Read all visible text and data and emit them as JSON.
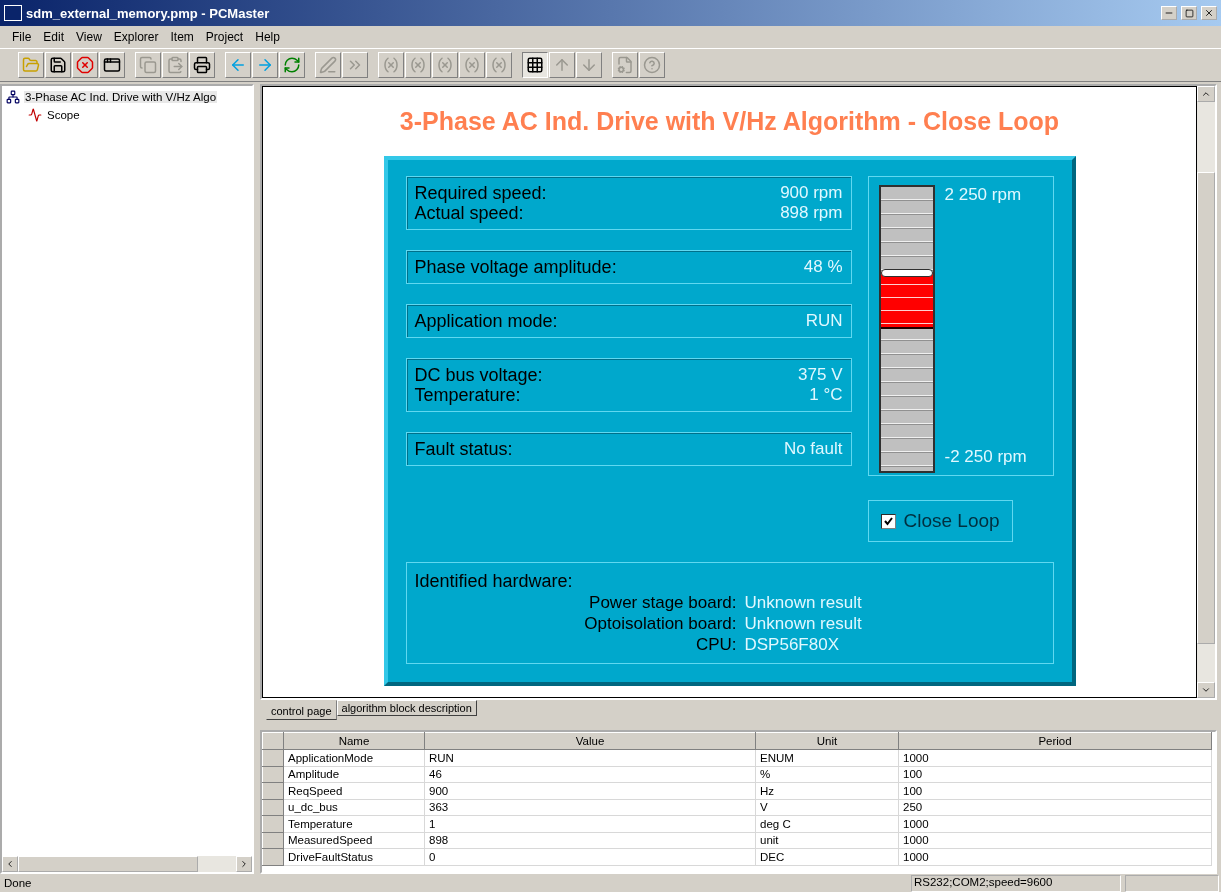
{
  "window": {
    "title": "sdm_external_memory.pmp - PCMaster"
  },
  "menu": [
    "File",
    "Edit",
    "View",
    "Explorer",
    "Item",
    "Project",
    "Help"
  ],
  "toolbar": [
    {
      "kind": "open",
      "disabled": false
    },
    {
      "kind": "save",
      "disabled": false
    },
    {
      "kind": "stop",
      "disabled": false
    },
    {
      "kind": "window",
      "disabled": false
    },
    {
      "kind": "sep"
    },
    {
      "kind": "copy",
      "disabled": true
    },
    {
      "kind": "paste",
      "disabled": true
    },
    {
      "kind": "print",
      "disabled": false
    },
    {
      "kind": "sep"
    },
    {
      "kind": "back",
      "disabled": false
    },
    {
      "kind": "forward",
      "disabled": false
    },
    {
      "kind": "refresh",
      "disabled": false
    },
    {
      "kind": "sep"
    },
    {
      "kind": "edit",
      "disabled": true
    },
    {
      "kind": "more",
      "disabled": true
    },
    {
      "kind": "sep"
    },
    {
      "kind": "var",
      "disabled": true
    },
    {
      "kind": "var",
      "disabled": true
    },
    {
      "kind": "var",
      "disabled": true
    },
    {
      "kind": "var",
      "disabled": true
    },
    {
      "kind": "var",
      "disabled": true
    },
    {
      "kind": "sep"
    },
    {
      "kind": "grid",
      "disabled": false
    },
    {
      "kind": "up",
      "disabled": true
    },
    {
      "kind": "down",
      "disabled": true
    },
    {
      "kind": "sep"
    },
    {
      "kind": "props",
      "disabled": true
    },
    {
      "kind": "help",
      "disabled": true
    }
  ],
  "tree": [
    {
      "label": "3-Phase AC Ind. Drive with V/Hz Algo",
      "selected": true,
      "children": [
        {
          "label": "Scope",
          "selected": false
        }
      ]
    }
  ],
  "page": {
    "title": "3-Phase AC Ind. Drive with V/Hz Algorithm - Close Loop",
    "groups": [
      [
        {
          "label": "Required speed:",
          "value": "900 rpm"
        },
        {
          "label": "Actual speed:",
          "value": "898 rpm"
        }
      ],
      [
        {
          "label": "Phase voltage amplitude:",
          "value": "48 %"
        }
      ],
      [
        {
          "label": "Application mode:",
          "value": "RUN"
        }
      ],
      [
        {
          "label": "DC bus voltage:",
          "value": "375 V"
        },
        {
          "label": "Temperature:",
          "value": "1 °C"
        }
      ],
      [
        {
          "label": "Fault status:",
          "value": "No fault"
        }
      ]
    ],
    "slider": {
      "max_label": "2 250 rpm",
      "min_label": "-2 250 rpm",
      "level": 0.7
    },
    "close_loop": {
      "label": "Close Loop",
      "checked": true
    },
    "hardware": {
      "title": "Identified hardware:",
      "rows": [
        {
          "label": "Power stage board:",
          "value": "Unknown result"
        },
        {
          "label": "Optoisolation board:",
          "value": "Unknown result"
        },
        {
          "label": "CPU:",
          "value": "DSP56F80X"
        }
      ]
    }
  },
  "tabs": [
    {
      "label": "control page",
      "selected": true
    },
    {
      "label": "algorithm block description",
      "selected": false
    }
  ],
  "table": {
    "columns": [
      "Name",
      "Value",
      "Unit",
      "Period"
    ],
    "rows": [
      [
        "ApplicationMode",
        "RUN",
        "ENUM",
        "1000"
      ],
      [
        "Amplitude",
        "46",
        "%",
        "100"
      ],
      [
        "ReqSpeed",
        "900",
        "Hz",
        "100"
      ],
      [
        "u_dc_bus",
        "363",
        "V",
        "250"
      ],
      [
        "Temperature",
        "1",
        "deg C",
        "1000"
      ],
      [
        "MeasuredSpeed",
        "898",
        "unit",
        "1000"
      ],
      [
        "DriveFaultStatus",
        "0",
        "DEC",
        "1000"
      ]
    ]
  },
  "status_bar": [
    "Done",
    "RS232;COM2;speed=9600"
  ]
}
